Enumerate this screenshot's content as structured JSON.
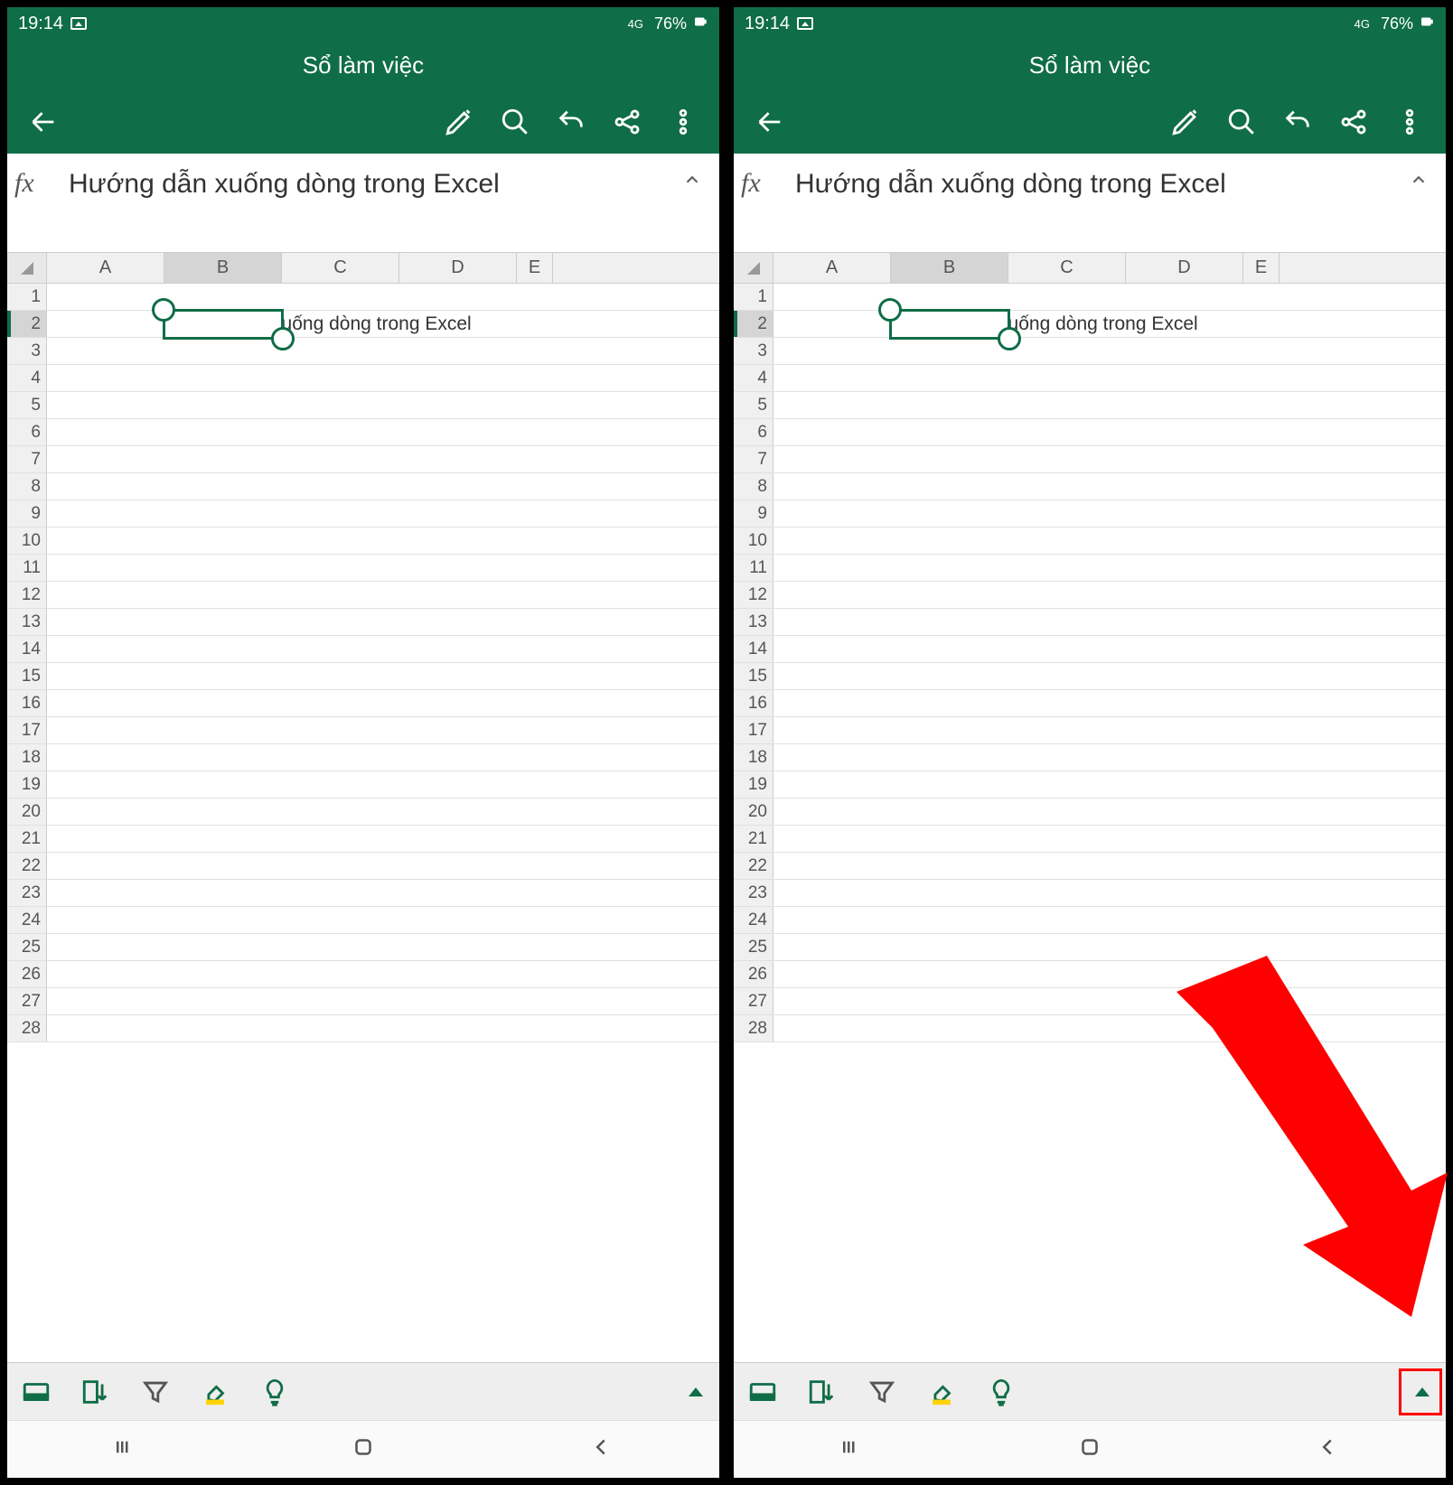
{
  "status": {
    "time": "19:14",
    "network_label": "4G",
    "battery": "76%"
  },
  "header": {
    "title": "Sổ làm việc"
  },
  "formula_bar": {
    "fx_label": "fx",
    "text": "Hướng dẫn xuống dòng trong Excel"
  },
  "columns": [
    "A",
    "B",
    "C",
    "D",
    "E"
  ],
  "rows": [
    1,
    2,
    3,
    4,
    5,
    6,
    7,
    8,
    9,
    10,
    11,
    12,
    13,
    14,
    15,
    16,
    17,
    18,
    19,
    20,
    21,
    22,
    23,
    24,
    25,
    26,
    27,
    28
  ],
  "selected": {
    "col": "B",
    "row": 2
  },
  "cell_content": {
    "B2": "Hướng dẫn xuống dòng trong Excel"
  },
  "icons": {
    "back": "back-arrow",
    "draw": "pen-sparkle",
    "search": "magnifier",
    "undo": "undo",
    "share": "share",
    "more": "vertical-dots",
    "collapse": "chevron-up",
    "bottom": [
      "card",
      "sort",
      "filter",
      "fill",
      "bulb"
    ],
    "nav": [
      "recents",
      "home",
      "back"
    ]
  }
}
